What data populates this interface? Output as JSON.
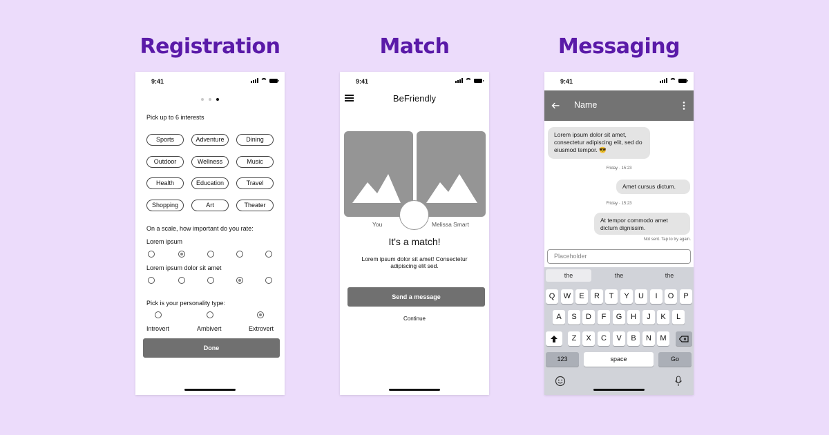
{
  "titles": {
    "registration": "Registration",
    "match": "Match",
    "messaging": "Messaging"
  },
  "status_time": "9:41",
  "registration": {
    "prompt_interests": "Pick up to 6 interests",
    "interests": [
      "Sports",
      "Adventure",
      "Dining",
      "Outdoor",
      "Wellness",
      "Music",
      "Health",
      "Education",
      "Travel",
      "Shopping",
      "Art",
      "Theater"
    ],
    "scale_prompt": "On a scale, how important do you rate:",
    "scale_items": [
      {
        "label": "Lorem ipsum",
        "selected_index": 1
      },
      {
        "label": "Lorem ipsum dolor sit amet",
        "selected_index": 3
      }
    ],
    "personality_prompt": "Pick is your personality type:",
    "personality_options": [
      "Introvert",
      "Ambivert",
      "Extrovert"
    ],
    "personality_selected_index": 2,
    "done_label": "Done",
    "page_indicator": {
      "total": 3,
      "current": 3
    }
  },
  "match": {
    "app_title": "BeFriendly",
    "you_label": "You",
    "other_label": "Melissa Smart",
    "headline": "It's a match!",
    "body": "Lorem ipsum dolor sit amet! Consectetur adipiscing elit sed.",
    "send_label": "Send a message",
    "continue_label": "Continue"
  },
  "messaging": {
    "contact_name": "Name",
    "messages": [
      {
        "text": "Lorem ipsum dolor sit amet, consectetur adipiscing elit, sed do eiusmod tempor. 😎",
        "from": "them"
      },
      {
        "stamp": "Friday · 15:23"
      },
      {
        "text": "Amet cursus dictum.",
        "from": "me"
      },
      {
        "stamp": "Friday · 15:23"
      },
      {
        "text": "At tempor commodo amet dictum dignissim.",
        "from": "me"
      }
    ],
    "not_sent": "Not sent. Tap to try again.",
    "input_placeholder": "Placeholder",
    "suggestions": [
      "the",
      "the",
      "the"
    ],
    "keys_row1": [
      "Q",
      "W",
      "E",
      "R",
      "T",
      "Y",
      "U",
      "I",
      "O",
      "P"
    ],
    "keys_row2": [
      "A",
      "S",
      "D",
      "F",
      "G",
      "H",
      "J",
      "K",
      "L"
    ],
    "keys_row3": [
      "Z",
      "X",
      "C",
      "V",
      "B",
      "N",
      "M"
    ],
    "key_123": "123",
    "key_space": "space",
    "key_go": "Go"
  },
  "icons": {
    "menu": "hamburger-icon",
    "back": "arrow-left-icon",
    "more": "kebab-menu-icon",
    "emoji": "emoji-icon",
    "mic": "microphone-icon",
    "shift": "shift-icon",
    "delete": "backspace-icon"
  }
}
